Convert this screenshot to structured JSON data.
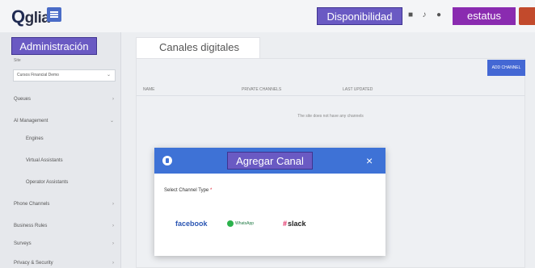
{
  "header": {
    "logo_text": "glia",
    "logo_initial": "Q",
    "disponibilidad_label": "Disponibilidad",
    "estatus_label": "estatus",
    "icons": [
      "video-icon",
      "microphone-icon",
      "settings-icon"
    ]
  },
  "sidebar": {
    "admin_label": "Administración",
    "site_label": "Site",
    "site_select_value": "Cursos Financial Demo",
    "items": [
      {
        "label": "Queues",
        "has_chevron": true
      },
      {
        "label": "AI Management",
        "has_chevron": true,
        "expanded": true
      },
      {
        "label": "Engines",
        "sub": true
      },
      {
        "label": "Virtual Assistants",
        "sub": true
      },
      {
        "label": "Operator Assistants",
        "sub": true
      },
      {
        "label": "Phone Channels",
        "has_chevron": true
      },
      {
        "label": "Business Rules",
        "has_chevron": true
      },
      {
        "label": "Surveys",
        "has_chevron": true
      },
      {
        "label": "Privacy & Security",
        "has_chevron": true
      }
    ]
  },
  "main": {
    "tab_label": "Canales digitales",
    "add_channel_label": "ADD CHANNEL",
    "columns": [
      "NAME",
      "PRIVATE CHANNELS",
      "LAST UPDATED"
    ],
    "empty_message": "The site does not have any channels"
  },
  "modal": {
    "title": "Agregar Canal",
    "close_symbol": "×",
    "field_label": "Select Channel Type",
    "required_marker": "*",
    "channels": [
      "facebook",
      "WhatsApp",
      "slack"
    ]
  },
  "colors": {
    "accent_purple": "#6a5ac3",
    "estatus_purple": "#8a2bb0",
    "primary_blue": "#3e72d6",
    "facebook_blue": "#2b56b3",
    "whatsapp_green": "#2bb24c",
    "slack_pink": "#e01e5a"
  }
}
